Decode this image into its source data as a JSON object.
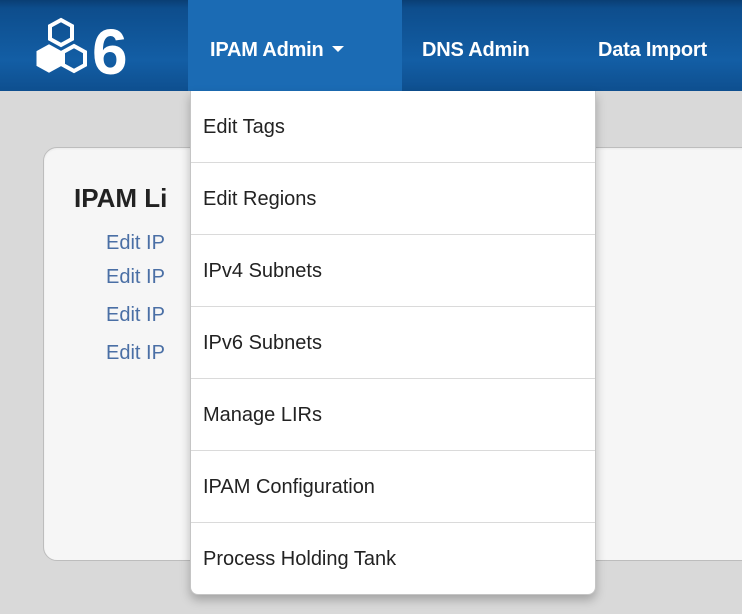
{
  "app": {
    "logo": "6"
  },
  "nav": {
    "items": [
      {
        "label": "IPAM Admin"
      },
      {
        "label": "DNS Admin"
      },
      {
        "label": "Data Import"
      }
    ]
  },
  "panel": {
    "title": "IPAM Li",
    "links": [
      "Edit IP",
      "Edit IP",
      "Edit IP",
      "Edit IP"
    ]
  },
  "dropdown": {
    "items": [
      "Edit Tags",
      "Edit Regions",
      "IPv4 Subnets",
      "IPv6 Subnets",
      "Manage LIRs",
      "IPAM Configuration",
      "Process Holding Tank"
    ]
  },
  "colors": {
    "navbar": "#135ea5",
    "active_nav": "#1b6bb4",
    "link": "#4a6fa5"
  }
}
